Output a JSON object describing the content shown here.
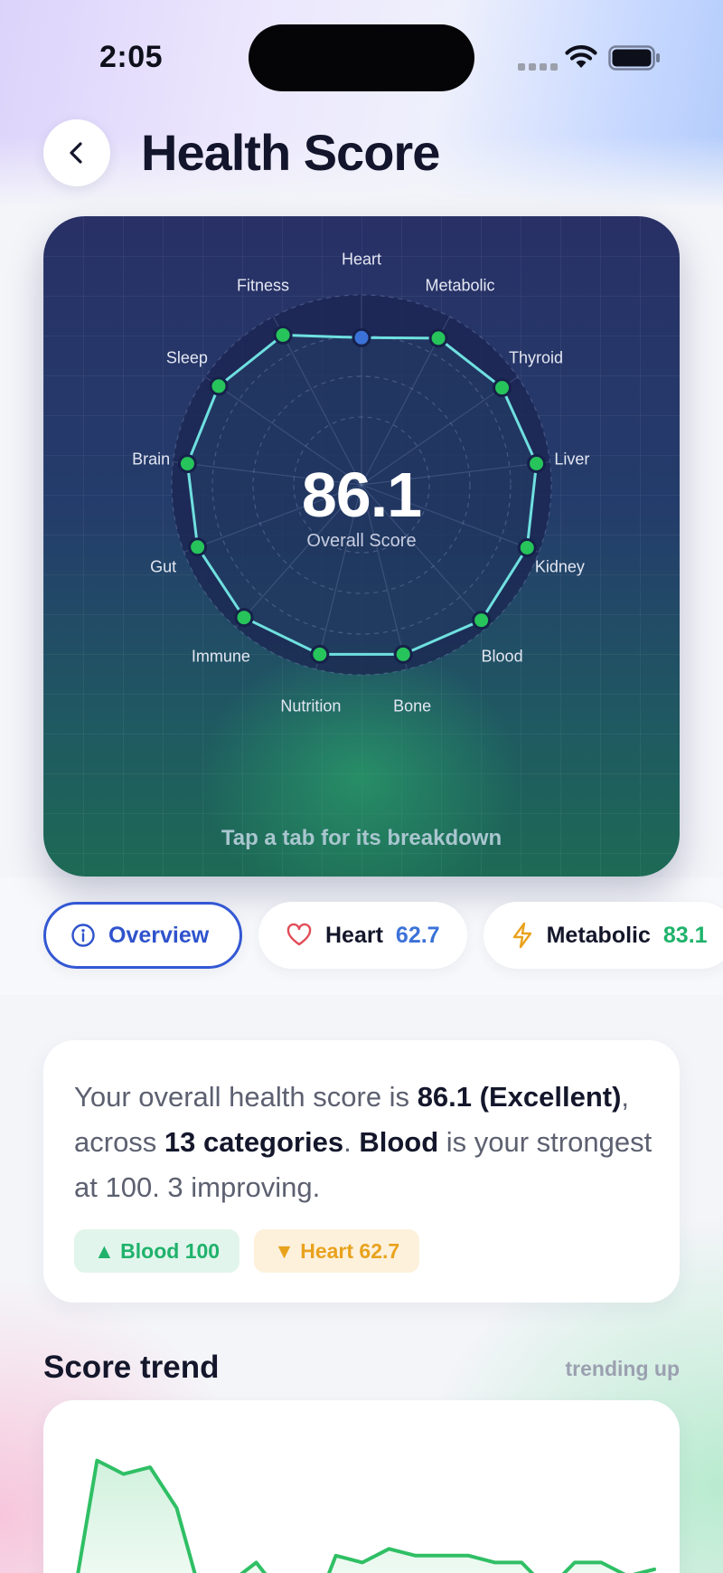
{
  "status_bar": {
    "time": "2:05"
  },
  "header": {
    "title": "Health Score"
  },
  "radar": {
    "overall_score": "86.1",
    "overall_label": "Overall Score",
    "hint": "Tap a tab for its breakdown",
    "categories": [
      {
        "label": "Heart",
        "score": 62.7
      },
      {
        "label": "Metabolic",
        "score": 83.1
      },
      {
        "label": "Thyroid",
        "score": 89
      },
      {
        "label": "Liver",
        "score": 95
      },
      {
        "label": "Kidney",
        "score": 96
      },
      {
        "label": "Blood",
        "score": 100
      },
      {
        "label": "Bone",
        "score": 93
      },
      {
        "label": "Nutrition",
        "score": 93
      },
      {
        "label": "Immune",
        "score": 96
      },
      {
        "label": "Gut",
        "score": 94
      },
      {
        "label": "Brain",
        "score": 94
      },
      {
        "label": "Sleep",
        "score": 92
      },
      {
        "label": "Fitness",
        "score": 87
      }
    ]
  },
  "tabs": [
    {
      "label": "Overview",
      "icon": "info-icon"
    },
    {
      "label": "Heart",
      "value": "62.7",
      "icon": "heart-icon",
      "value_color": "#3b72d8"
    },
    {
      "label": "Metabolic",
      "value": "83.1",
      "icon": "lightning-icon",
      "value_color": "#1fb26b"
    }
  ],
  "summary": {
    "p1": "Your overall health score is ",
    "score": "86.1 (Excellent)",
    "p2": ", across ",
    "categories": "13 categories",
    "p3": ". ",
    "strongest": "Blood",
    "p4": " is your strongest at 100. 3 improving.",
    "chip_up": "▲ Blood 100",
    "chip_down": "▼ Heart 62.7"
  },
  "trend": {
    "title": "Score trend",
    "badge": "trending up",
    "values": [
      78,
      97,
      95,
      96,
      90,
      76,
      79,
      82,
      77,
      73,
      83,
      82,
      84,
      83,
      83,
      83,
      82,
      82,
      78,
      82,
      82,
      80,
      81
    ]
  },
  "colors": {
    "accent": "#3358d4",
    "good": "#1fb26b",
    "warn": "#e9a21d",
    "heart_dot": "#3b72d8",
    "radar_line": "#6fe0e0"
  }
}
